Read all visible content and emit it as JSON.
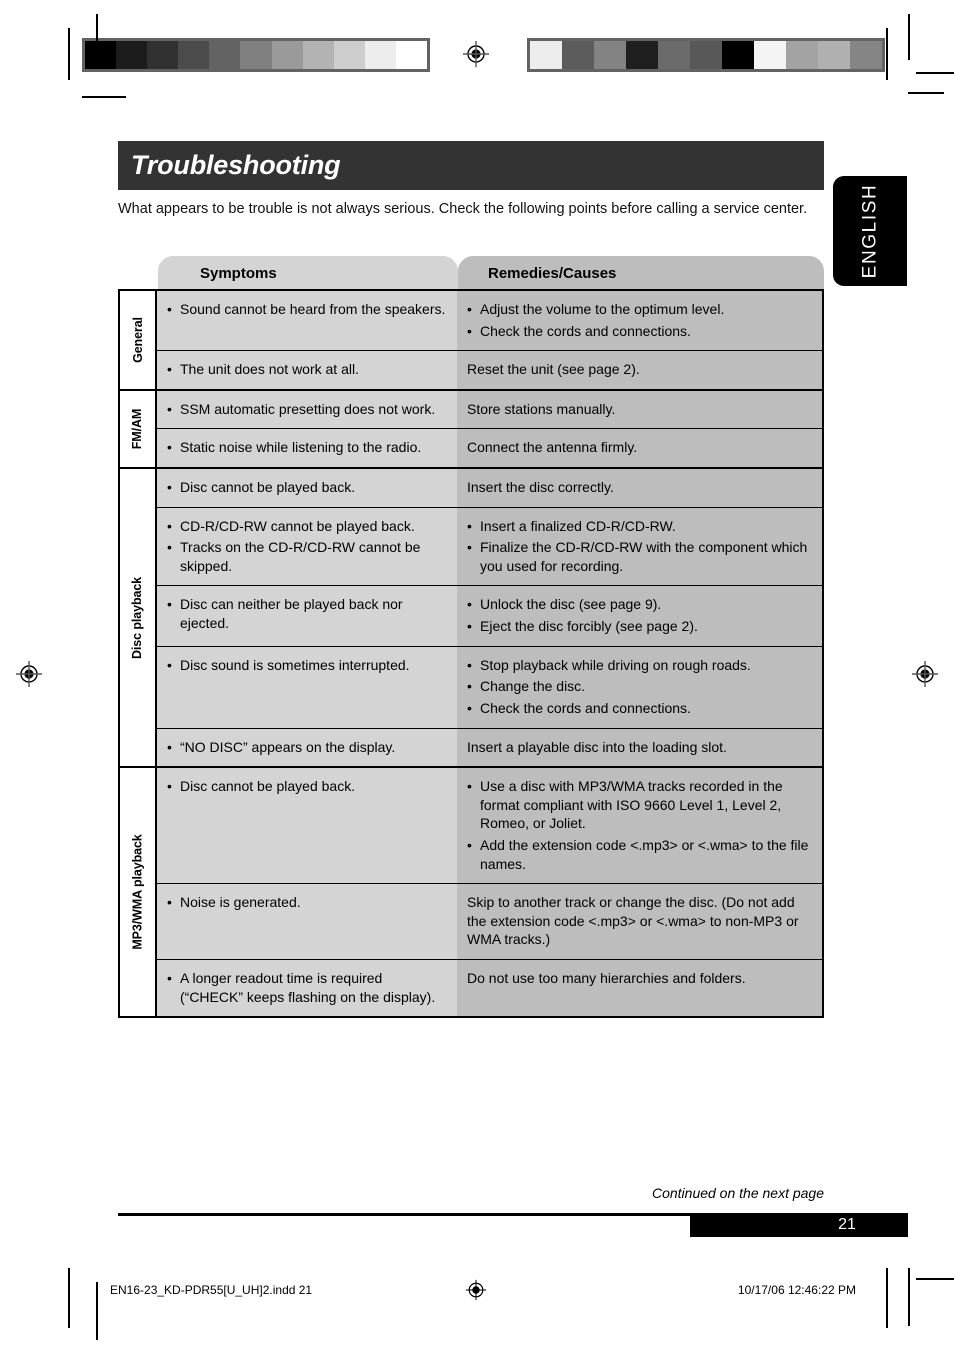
{
  "document": {
    "title": "Troubleshooting",
    "intro": "What appears to be trouble is not always serious. Check the following points before calling a service center.",
    "language_tab": "ENGLISH",
    "continued_note": "Continued on the next page",
    "page_number": "21"
  },
  "table": {
    "headers": {
      "symptoms": "Symptoms",
      "remedies": "Remedies/Causes"
    },
    "groups": [
      {
        "label": "General",
        "rows": [
          {
            "symptoms": [
              "Sound cannot be heard from the speakers."
            ],
            "symptoms_bulleted": true,
            "remedies": [
              "Adjust the volume to the optimum level.",
              "Check the cords and connections."
            ],
            "remedies_bulleted": true
          },
          {
            "symptoms": [
              "The unit does not work at all."
            ],
            "symptoms_bulleted": true,
            "remedies": [
              "Reset the unit (see page 2)."
            ],
            "remedies_bulleted": false
          }
        ]
      },
      {
        "label": "FM/AM",
        "rows": [
          {
            "symptoms": [
              "SSM automatic presetting does not work."
            ],
            "symptoms_bulleted": true,
            "remedies": [
              "Store stations manually."
            ],
            "remedies_bulleted": false
          },
          {
            "symptoms": [
              "Static noise while listening to the radio."
            ],
            "symptoms_bulleted": true,
            "remedies": [
              "Connect the antenna firmly."
            ],
            "remedies_bulleted": false
          }
        ]
      },
      {
        "label": "Disc playback",
        "rows": [
          {
            "symptoms": [
              "Disc cannot be played back."
            ],
            "symptoms_bulleted": true,
            "remedies": [
              "Insert the disc correctly."
            ],
            "remedies_bulleted": false
          },
          {
            "symptoms": [
              "CD-R/CD-RW cannot be played back.",
              "Tracks on the CD-R/CD-RW cannot be skipped."
            ],
            "symptoms_bulleted": true,
            "remedies": [
              "Insert a finalized CD-R/CD-RW.",
              "Finalize the CD-R/CD-RW with the component which you used for recording."
            ],
            "remedies_bulleted": true
          },
          {
            "symptoms": [
              "Disc can neither be played back nor ejected."
            ],
            "symptoms_bulleted": true,
            "remedies": [
              "Unlock the disc (see page 9).",
              "Eject the disc forcibly (see page 2)."
            ],
            "remedies_bulleted": true
          },
          {
            "symptoms": [
              "Disc sound is sometimes interrupted."
            ],
            "symptoms_bulleted": true,
            "remedies": [
              "Stop playback while driving on rough roads.",
              "Change the disc.",
              "Check the cords and connections."
            ],
            "remedies_bulleted": true
          },
          {
            "symptoms": [
              "“NO DISC” appears on the display."
            ],
            "symptoms_bulleted": true,
            "remedies": [
              "Insert a playable disc into the loading slot."
            ],
            "remedies_bulleted": false
          }
        ]
      },
      {
        "label": "MP3/WMA playback",
        "rows": [
          {
            "symptoms": [
              "Disc cannot be played back."
            ],
            "symptoms_bulleted": true,
            "remedies": [
              "Use a disc with MP3/WMA tracks recorded in the format compliant with ISO 9660 Level 1, Level 2, Romeo, or Joliet.",
              "Add the extension code <.mp3> or <.wma> to the file names."
            ],
            "remedies_bulleted": true
          },
          {
            "symptoms": [
              "Noise is generated."
            ],
            "symptoms_bulleted": true,
            "remedies": [
              "Skip to another track or change the disc. (Do not add the extension code <.mp3> or <.wma> to non-MP3 or WMA tracks.)"
            ],
            "remedies_bulleted": false
          },
          {
            "symptoms": [
              "A longer readout time is required (“CHECK” keeps flashing on the display)."
            ],
            "symptoms_bulleted": true,
            "remedies": [
              "Do not use too many hierarchies and folders."
            ],
            "remedies_bulleted": false
          }
        ]
      }
    ]
  },
  "print_footer": {
    "file_name": "EN16-23_KD-PDR55[U_UH]2.indd   21",
    "timestamp": "10/17/06   12:46:22 PM"
  },
  "calibration": {
    "left_strip": [
      "#000000",
      "#1c1c1c",
      "#313131",
      "#4b4b4b",
      "#636363",
      "#808080",
      "#9a9a9a",
      "#b3b3b3",
      "#cdcdcd",
      "#ededed",
      "#ffffff"
    ],
    "right_strip": [
      "#ededed",
      "#5c5c5c",
      "#838383",
      "#1f1f1f",
      "#6b6b6b",
      "#585858",
      "#000000",
      "#f4f4f4",
      "#a3a3a3",
      "#b0b0b0",
      "#858585"
    ]
  },
  "colors": {
    "title_bar": "#333333",
    "symptoms_cell": "#d4d4d4",
    "remedies_cell": "#bdbdbd",
    "header_symptoms": "#d4d4d4",
    "header_remedies": "#bdbdbd",
    "tab": "#000000"
  },
  "bullet_glyph": "•"
}
